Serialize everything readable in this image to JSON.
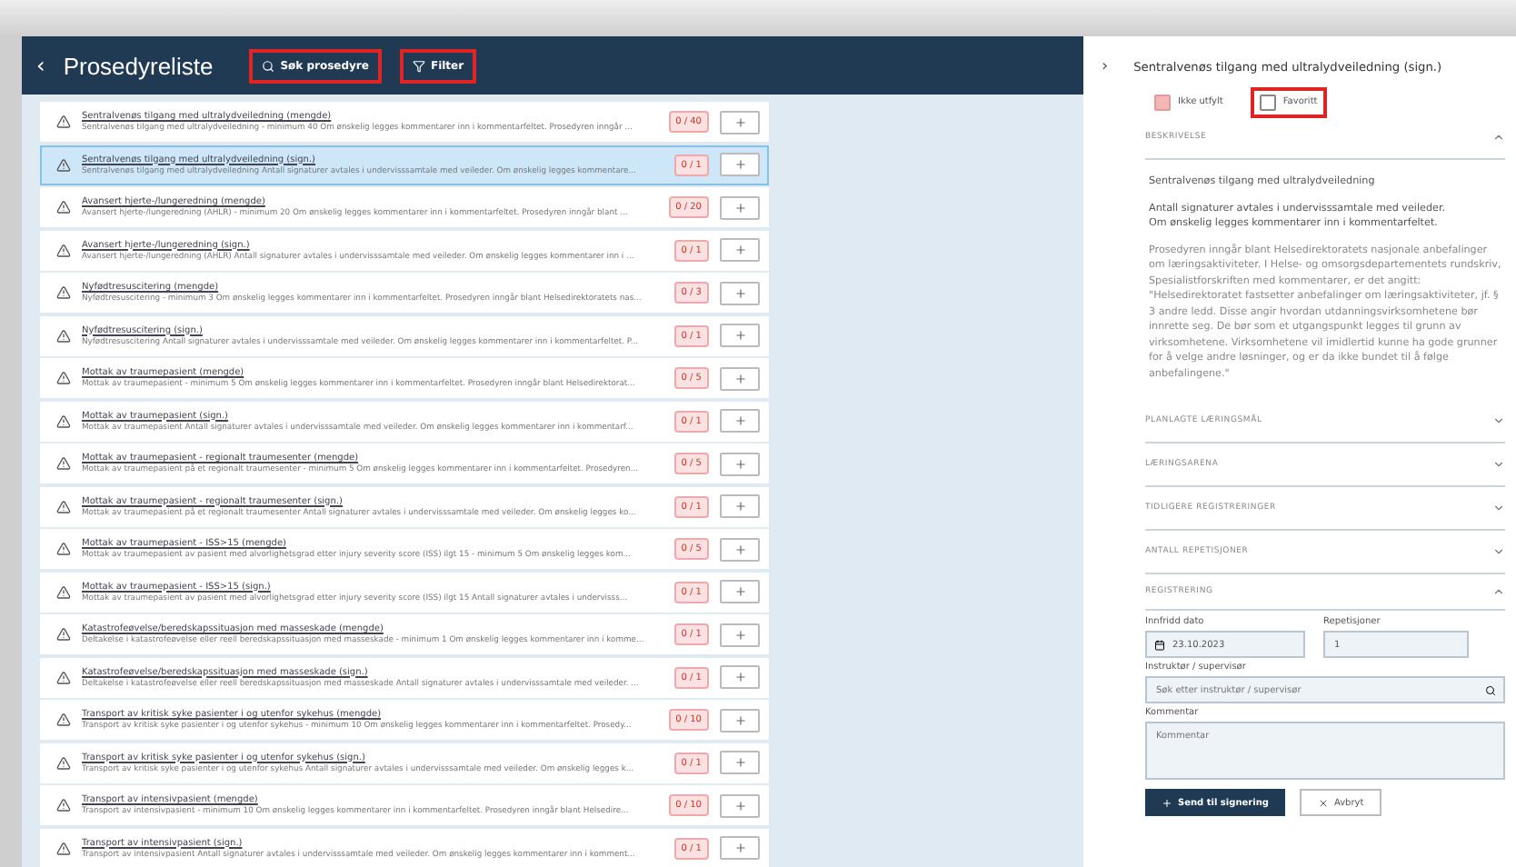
{
  "header": {
    "back": "‹",
    "title": "Prosedyreliste",
    "search_button": "Søk prosedyre",
    "filter_button": "Filter"
  },
  "procedures": [
    {
      "title": "Sentralvenøs tilgang med ultralydveiledning (mengde)",
      "description": "Sentralvenøs tilgang med ultralydveiledning - minimum 40 Om ønskelig legges kommentarer inn i kommentarfeltet. Prosedyren inngår ...",
      "count": "0 / 40",
      "selected": false
    },
    {
      "title": "Sentralvenøs tilgang med ultralydveiledning (sign.)",
      "description": "Sentralvenøs tilgang med ultralydveiledning Antall signaturer avtales i undervisssamtale med veileder. Om ønskelig legges kommentare...",
      "count": "0 / 1",
      "selected": true
    },
    {
      "title": "Avansert hjerte-/lungeredning (mengde)",
      "description": "Avansert hjerte-/lungeredning (AHLR) - minimum 20 Om ønskelig legges kommentarer inn i kommentarfeltet. Prosedyren inngår blant ...",
      "count": "0 / 20",
      "selected": false
    },
    {
      "title": "Avansert hjerte-/lungeredning (sign.)",
      "description": "Avansert hjerte-/lungeredning (AHLR) Antall signaturer avtales i undervisssamtale med veileder. Om ønskelig legges kommentarer inn i ...",
      "count": "0 / 1",
      "selected": false
    },
    {
      "title": "Nyfødtresuscitering (mengde)",
      "description": "Nyfødtresuscitering - minimum 3 Om ønskelig legges kommentarer inn i kommentarfeltet. Prosedyren inngår blant Helsedirektoratets nas...",
      "count": "0 / 3",
      "selected": false
    },
    {
      "title": "Nyfødtresuscitering (sign.)",
      "description": "Nyfødtresuscitering Antall signaturer avtales i undervisssamtale med veileder. Om ønskelig legges kommentarer inn i kommentarfeltet. P...",
      "count": "0 / 1",
      "selected": false
    },
    {
      "title": "Mottak av traumepasient (mengde)",
      "description": "Mottak av traumepasient - minimum 5 Om ønskelig legges kommentarer inn i kommentarfeltet. Prosedyren inngår blant Helsedirektorat...",
      "count": "0 / 5",
      "selected": false
    },
    {
      "title": "Mottak av traumepasient (sign.)",
      "description": "Mottak av traumepasient Antall signaturer avtales i undervisssamtale med veileder. Om ønskelig legges kommentarer inn i kommentarf...",
      "count": "0 / 1",
      "selected": false
    },
    {
      "title": "Mottak av traumepasient - regionalt traumesenter (mengde)",
      "description": "Mottak av traumepasient på et regionalt traumesenter - minimum 5 Om ønskelig legges kommentarer inn i kommentarfeltet. Prosedyren...",
      "count": "0 / 5",
      "selected": false
    },
    {
      "title": "Mottak av traumepasient - regionalt traumesenter (sign.)",
      "description": "Mottak av traumepasient på et regionalt traumesenter Antall signaturer avtales i undervisssamtale med veileder. Om ønskelig legges ko...",
      "count": "0 / 1",
      "selected": false
    },
    {
      "title": "Mottak av traumepasient - ISS>15 (mengde)",
      "description": "Mottak av traumepasient av pasient med alvorlighetsgrad etter injury severity score (ISS) ilgt 15 - minimum 5 Om ønskelig legges kom...",
      "count": "0 / 5",
      "selected": false
    },
    {
      "title": "Mottak av traumepasient - ISS>15 (sign.)",
      "description": "Mottak av traumepasient av pasient med alvorlighetsgrad etter injury severity score (ISS) ilgt 15 Antall signaturer avtales i undervisss...",
      "count": "0 / 1",
      "selected": false
    },
    {
      "title": "Katastrofeøvelse/beredskapssituasjon med masseskade (mengde)",
      "description": "Deltakelse i katastrofeøvelse eller reell beredskapssituasjon med masseskade - minimum 1 Om ønskelig legges kommentarer inn i komme...",
      "count": "0 / 1",
      "selected": false
    },
    {
      "title": "Katastrofeøvelse/beredskapssituasjon med masseskade (sign.)",
      "description": "Deltakelse i katastrofeøvelse eller reell beredskapssituasjon med masseskade Antall signaturer avtales i undervisssamtale med veileder. ...",
      "count": "0 / 1",
      "selected": false
    },
    {
      "title": "Transport av kritisk syke pasienter i og utenfor sykehus (mengde)",
      "description": "Transport av kritisk syke pasienter i og utenfor sykehus - minimum 10 Om ønskelig legges kommentarer inn i kommentarfeltet. Prosedy...",
      "count": "0 / 10",
      "selected": false
    },
    {
      "title": "Transport av kritisk syke pasienter i og utenfor sykehus (sign.)",
      "description": "Transport av kritisk syke pasienter i og utenfor sykehus Antall signaturer avtales i undervisssamtale med veileder. Om ønskelig legges k...",
      "count": "0 / 1",
      "selected": false
    },
    {
      "title": "Transport av intensivpasient (mengde)",
      "description": "Transport av intensivpasient - minimum 10 Om ønskelig legges kommentarer inn i kommentarfeltet. Prosedyren inngår blant Helsedire...",
      "count": "0 / 10",
      "selected": false
    },
    {
      "title": "Transport av intensivpasient (sign.)",
      "description": "Transport av intensivpasient Antall signaturer avtales i undervisssamtale med veileder. Om ønskelig legges kommentarer inn i komment...",
      "count": "0 / 1",
      "selected": false
    }
  ],
  "detail": {
    "chevron": "›",
    "title": "Sentralvenøs tilgang med ultralydveiledning (sign.)",
    "checkboxes": [
      {
        "label": "Ikke utfylt",
        "checked": true
      },
      {
        "label": "Favoritt",
        "checked": false
      }
    ],
    "sections": [
      {
        "heading": "BESKRIVELSE",
        "expanded": true,
        "kind": "text",
        "paragraphs": [
          "Sentralvenøs tilgang med ultralydveiledning",
          "Antall signaturer avtales i undervisssamtale med veileder.",
          "Om ønskelig legges kommentarer inn i kommentarfeltet.",
          "Prosedyren inngår blant Helsedirektoratets nasjonale anbefalinger om læringsaktiviteter. I Helse- og omsorgsdepartementets rundskriv, Spesialistforskriften med kommentarer, er det angitt: \"Helsedirektoratet fastsetter anbefalinger om læringsaktiviteter, jf. § 3 andre ledd. Disse angir hvordan utdanningsvirksomhetene bør innrette seg. De bør som et utgangspunkt legges til grunn av virksomhetene. Virksomhetene vil imidlertid kunne ha gode grunner for å velge andre løsninger, og er da ikke bundet til å følge anbefalingene.\""
        ]
      },
      {
        "heading": "PLANLAGTE LÆRINGSMÅL",
        "expanded": false,
        "kind": "text"
      },
      {
        "heading": "LÆRINGSARENA",
        "expanded": false,
        "kind": "text"
      },
      {
        "heading": "TIDLIGERE REGISTRERINGER",
        "expanded": false,
        "kind": "text"
      },
      {
        "heading": "ANTALL REPETISJONER",
        "expanded": false,
        "kind": "text"
      },
      {
        "heading": "REGISTRERING",
        "expanded": true,
        "kind": "form"
      }
    ],
    "form": {
      "date_label": "Innfridd dato",
      "date_value": "23.10.2023",
      "reps_label": "Repetisjoner",
      "reps_value": "1",
      "instructor_label": "Instruktør / supervisør",
      "instructor_placeholder": "Søk etter instruktør / supervisør",
      "comment_label": "Kommentar",
      "comment_placeholder": "Kommentar",
      "submit": "Send til signering",
      "cancel": "Avbryt"
    }
  }
}
